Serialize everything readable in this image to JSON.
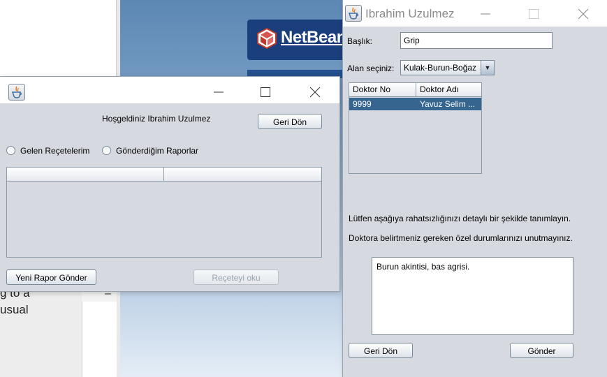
{
  "background": {
    "netbeans_logo_text": "NetBeans",
    "partial_text": "g to a\nusual",
    "minus_glyph": "–"
  },
  "window_left": {
    "title": "",
    "welcome_text": "Hoşgeldiniz Ibrahim Uzulmez",
    "back_button": "Geri Dön",
    "radio_received": "Gelen Reçetelerim",
    "radio_sent": "Gönderdiğim Raporlar",
    "table_headers": [
      "",
      ""
    ],
    "new_report_button": "Yeni Rapor Gönder",
    "read_prescription_button": "Reçeteyi oku"
  },
  "window_right": {
    "title": "Ibrahim Uzulmez",
    "subject_label": "Başlık:",
    "subject_value": "Grip",
    "field_label": "Alan seçiniz:",
    "field_value": "Kulak-Burun-Boğaz",
    "table_headers": [
      "Doktor No",
      "Doktor Adı"
    ],
    "table_rows": [
      [
        "9999",
        "Yavuz Selim ..."
      ]
    ],
    "info_line_1": "Lütfen aşağıya rahatsızlığınızı detaylı bir şekilde tanımlayın.",
    "info_line_2": "Doktora belirtmeniz gereken özel durumlarınızı unutmayınız.",
    "description_value": "Burun akintisi, bas agrisi.",
    "back_button": "Geri Dön",
    "send_button": "Gönder"
  },
  "colors": {
    "window_bg": "#d6d9df",
    "selection": "#36658f",
    "netbeans_blue": "#1b3f7c"
  }
}
